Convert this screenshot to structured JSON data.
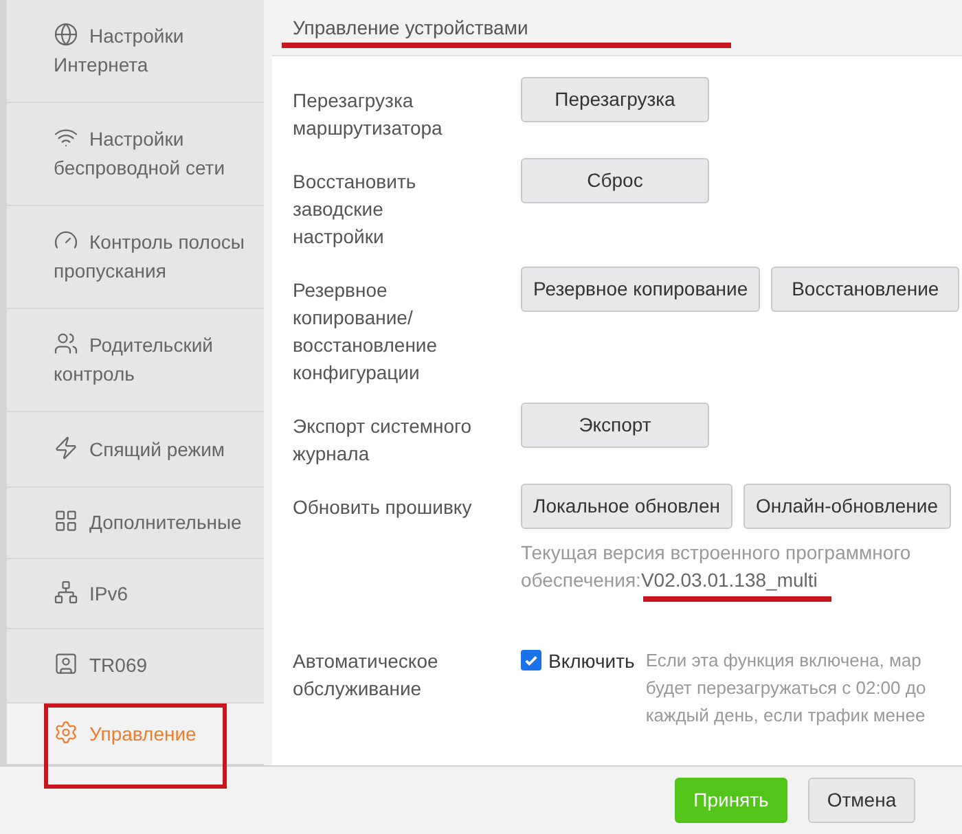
{
  "sidebar": {
    "items": [
      {
        "label": "Настройки Интернета",
        "selected": false,
        "highlighted": false
      },
      {
        "label": "Настройки беспроводной сети",
        "selected": false,
        "highlighted": false
      },
      {
        "label": "Контроль полосы пропускания",
        "selected": false,
        "highlighted": false
      },
      {
        "label": "Родительский контроль",
        "selected": false,
        "highlighted": false
      },
      {
        "label": "Спящий режим",
        "selected": false,
        "highlighted": false
      },
      {
        "label": "Дополнительные",
        "selected": false,
        "highlighted": false
      },
      {
        "label": "IPv6",
        "selected": false,
        "highlighted": false
      },
      {
        "label": "TR069",
        "selected": false,
        "highlighted": false
      },
      {
        "label": "Управление",
        "selected": true,
        "highlighted": true
      }
    ]
  },
  "section": {
    "title": "Управление устройствами",
    "underlined": true
  },
  "rows": [
    {
      "kind": "buttons",
      "label": "Перезагрузка маршрутизатора",
      "buttons": [
        "Перезагрузка"
      ]
    },
    {
      "kind": "buttons",
      "label": "Восстановить заводские настройки",
      "buttons": [
        "Сброс"
      ]
    },
    {
      "kind": "buttons",
      "label": "Резервное копирование/ восстановление конфигурации",
      "buttons": [
        "Резервное копирование",
        "Восстановление"
      ]
    },
    {
      "kind": "buttons",
      "label": "Экспорт системного журнала",
      "buttons": [
        "Экспорт"
      ]
    },
    {
      "kind": "buttons",
      "label": "Обновить прошивку",
      "buttons": [
        "Локальное обновлен",
        "Онлайн-обновление"
      ],
      "note": {
        "text": "Текущая версия встроенного программного обеспечения:",
        "version": "V02.03.01.138_multi",
        "underlined": true
      }
    },
    {
      "kind": "checkbox",
      "label": "Автоматическое обслуживание",
      "checkbox_label": "Включить",
      "checked": true,
      "description": [
        "Если эта функция включена, мар",
        "будет перезагружаться с 02:00 до",
        "каждый день, если трафик менее"
      ]
    }
  ],
  "footer": {
    "apply": "Принять",
    "cancel": "Отмена"
  }
}
